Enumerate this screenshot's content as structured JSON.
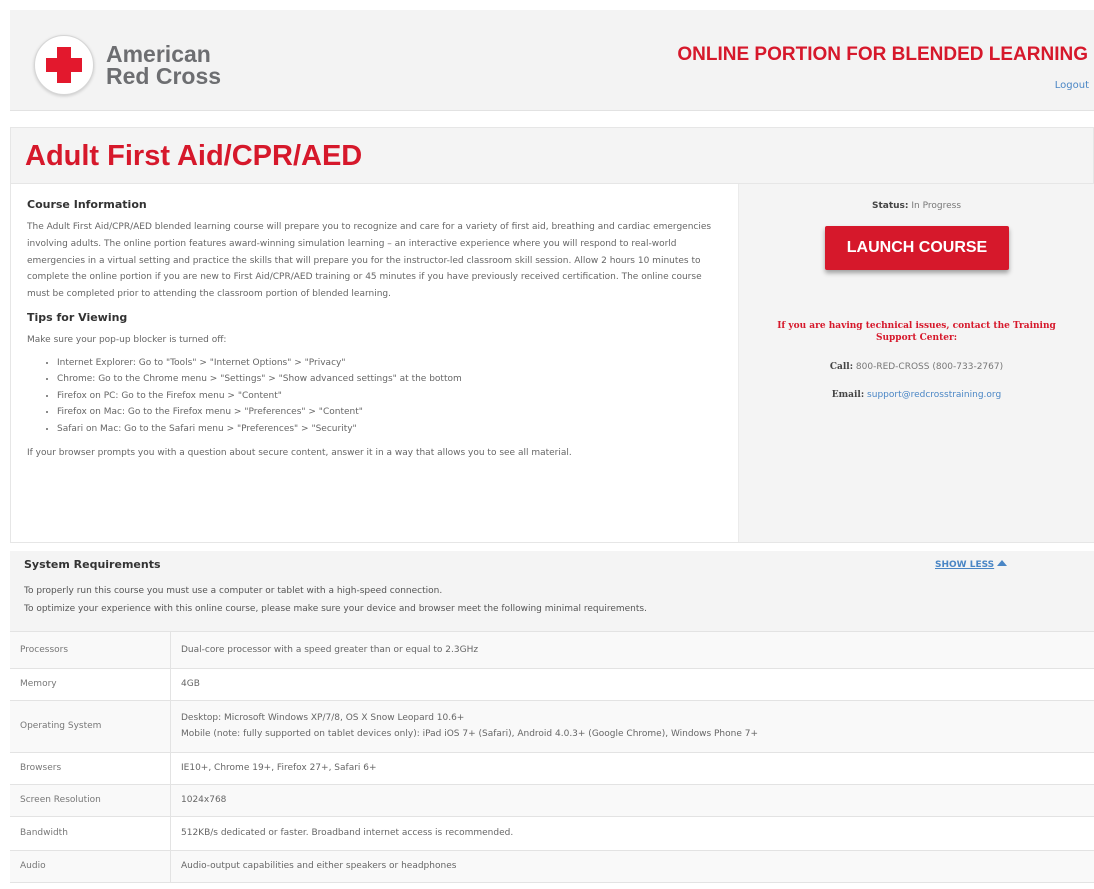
{
  "header": {
    "logo_line1": "American",
    "logo_line2": "Red Cross",
    "title": "ONLINE PORTION FOR BLENDED LEARNING",
    "logout": "Logout"
  },
  "course": {
    "title": "Adult First Aid/CPR/AED",
    "info_heading": "Course Information",
    "info_text": "The Adult First Aid/CPR/AED blended learning course will prepare you to recognize and care for a variety of first aid, breathing and cardiac emergencies involving adults. The online portion features award-winning simulation learning – an interactive experience where you will respond to real-world emergencies in a virtual setting and practice the skills that will prepare you for the instructor-led classroom skill session. Allow 2 hours 10 minutes to complete the online portion if you are new to First Aid/CPR/AED training or 45 minutes if you have previously received certification. The online course must be completed prior to attending the classroom portion of blended learning.",
    "tips_heading": "Tips for Viewing",
    "tips_intro": "Make sure your pop-up blocker is turned off:",
    "tips": [
      "Internet Explorer: Go to \"Tools\" > \"Internet Options\" > \"Privacy\"",
      "Chrome: Go to the Chrome menu > \"Settings\" > \"Show advanced settings\" at the bottom",
      "Firefox on PC: Go to the Firefox menu > \"Content\"",
      "Firefox on Mac: Go to the Firefox menu > \"Preferences\" > \"Content\"",
      "Safari on Mac: Go to the Safari menu > \"Preferences\" > \"Security\""
    ],
    "secure_note": "If your browser prompts you with a question about secure content, answer it in a way that allows you to see all material."
  },
  "sidebar": {
    "status_label": "Status:",
    "status_value": "In Progress",
    "launch_label": "LAUNCH COURSE",
    "tech_issue": "If you are having technical issues, contact the Training Support Center:",
    "call_label": "Call:",
    "call_value": "800-RED-CROSS (800-733-2767)",
    "email_label": "Email:",
    "email_value": "support@redcrosstraining.org"
  },
  "system_requirements": {
    "heading": "System Requirements",
    "toggle_label": "SHOW LESS",
    "line1": "To properly run this course you must use a computer or tablet with a high-speed connection.",
    "line2": "To optimize your experience with this online course, please make sure your device and browser meet the following minimal requirements.",
    "rows": [
      {
        "label": "Processors",
        "value": "Dual-core processor with a speed greater than or equal to 2.3GHz"
      },
      {
        "label": "Memory",
        "value": "4GB"
      },
      {
        "label": "Operating System",
        "value": "Desktop: Microsoft Windows XP/7/8, OS X Snow Leopard 10.6+",
        "value2": "Mobile (note: fully supported on tablet devices only): iPad iOS 7+ (Safari), Android 4.0.3+ (Google Chrome), Windows Phone 7+"
      },
      {
        "label": "Browsers",
        "value": "IE10+, Chrome 19+, Firefox 27+, Safari 6+"
      },
      {
        "label": "Screen Resolution",
        "value": "1024x768"
      },
      {
        "label": "Bandwidth",
        "value": "512KB/s dedicated or faster. Broadband internet access is recommended."
      },
      {
        "label": "Audio",
        "value": "Audio-output capabilities and either speakers or headphones"
      }
    ]
  },
  "colors": {
    "brand_red": "#d6182b",
    "link_blue": "#4a86c5"
  }
}
